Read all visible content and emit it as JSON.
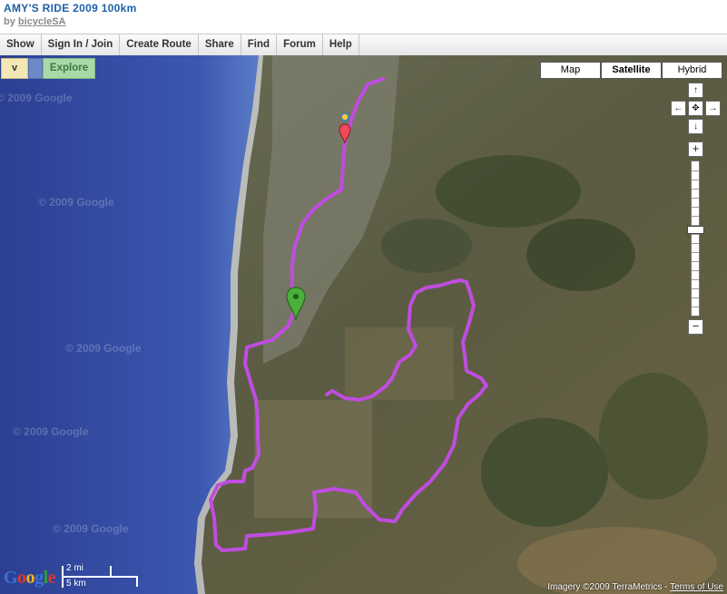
{
  "page": {
    "title": "AMY'S RIDE 2009 100km",
    "byline_prefix": "by",
    "author": "bicycleSA"
  },
  "nav": [
    "Show",
    "Sign In / Join",
    "Create Route",
    "Share",
    "Find",
    "Forum",
    "Help"
  ],
  "map_tools": {
    "toggle_label": "v",
    "explore_label": "Explore"
  },
  "map_types": {
    "options": [
      "Map",
      "Satellite",
      "Hybrid"
    ],
    "selected": "Satellite"
  },
  "pan_controls": {
    "up": "↑",
    "left": "←",
    "center": "✥",
    "right": "→",
    "down": "↓"
  },
  "zoom_controls": {
    "in": "+",
    "out": "−"
  },
  "watermark": "© 2009 Google",
  "scale": {
    "miles": "2 mi",
    "km": "5 km"
  },
  "logo_text": "Google",
  "attribution": {
    "imagery": "Imagery ©2009 TerraMetrics",
    "separator": " - ",
    "terms": "Terms of Use"
  },
  "colors": {
    "route": "#c04ce0",
    "ocean": "#2a3e92",
    "title": "#1e5fa8"
  }
}
